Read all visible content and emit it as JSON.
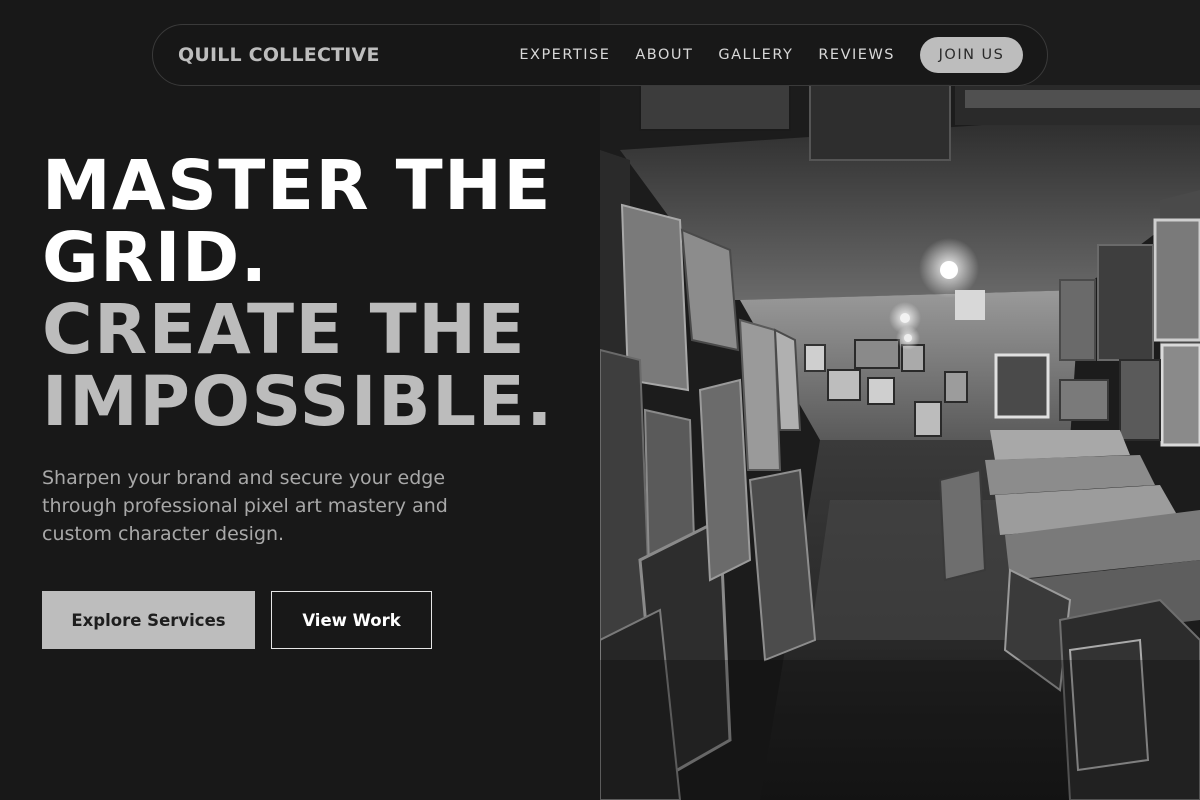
{
  "nav": {
    "brand": "QUILL COLLECTIVE",
    "links": [
      "EXPERTISE",
      "ABOUT",
      "GALLERY",
      "REVIEWS"
    ],
    "cta": "JOIN US"
  },
  "hero": {
    "line1": "MASTER THE",
    "line2": "GRID.",
    "line3": "CREATE THE",
    "line4": "IMPOSSIBLE.",
    "subtitle": "Sharpen your brand and secure your edge through professional pixel art mastery and custom character design.",
    "primary_button": "Explore Services",
    "secondary_button": "View Work"
  },
  "colors": {
    "background": "#181818",
    "accent": "#bdbdbd",
    "headline_white": "#ffffff",
    "headline_grey": "#bcbcbc"
  }
}
